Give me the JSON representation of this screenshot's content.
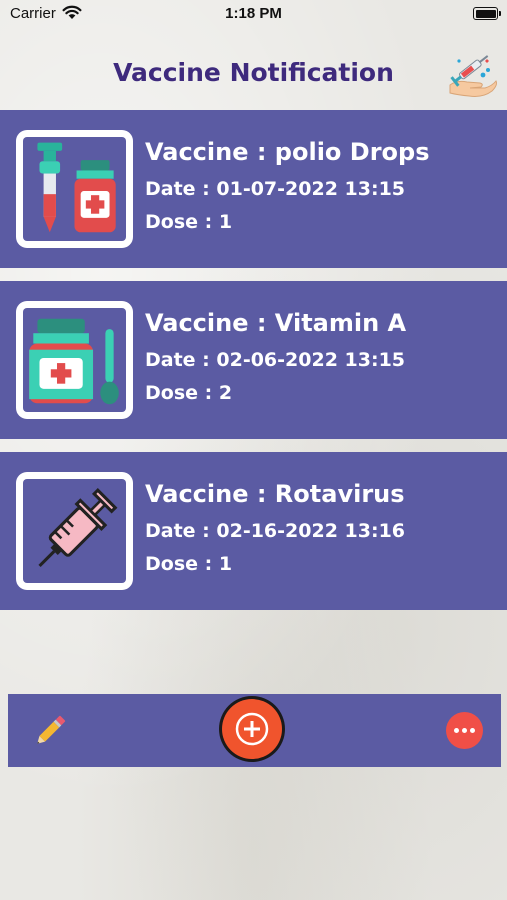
{
  "status_bar": {
    "carrier": "Carrier",
    "time": "1:18 PM"
  },
  "header": {
    "title": "Vaccine Notification",
    "logo_icon": "vaccine-hand-logo-icon"
  },
  "vaccines": [
    {
      "name": "Vaccine : polio Drops",
      "date": "Date : 01-07-2022 13:15",
      "dose": "Dose : 1",
      "icon": "dropper-bottle-icon"
    },
    {
      "name": "Vaccine : Vitamin A",
      "date": "Date : 02-06-2022 13:15",
      "dose": "Dose : 2",
      "icon": "medicine-bottle-spoon-icon"
    },
    {
      "name": "Vaccine : Rotavirus",
      "date": "Date : 02-16-2022 13:16",
      "dose": "Dose : 1",
      "icon": "syringe-icon"
    }
  ],
  "toolbar": {
    "edit_icon": "pencil-icon",
    "add_icon": "plus-icon",
    "more_icon": "more-dots-icon"
  },
  "colors": {
    "accent": "#5b5ba3",
    "title": "#3e2a7d",
    "add_button": "#f0542d",
    "more_button": "#f04f47"
  }
}
